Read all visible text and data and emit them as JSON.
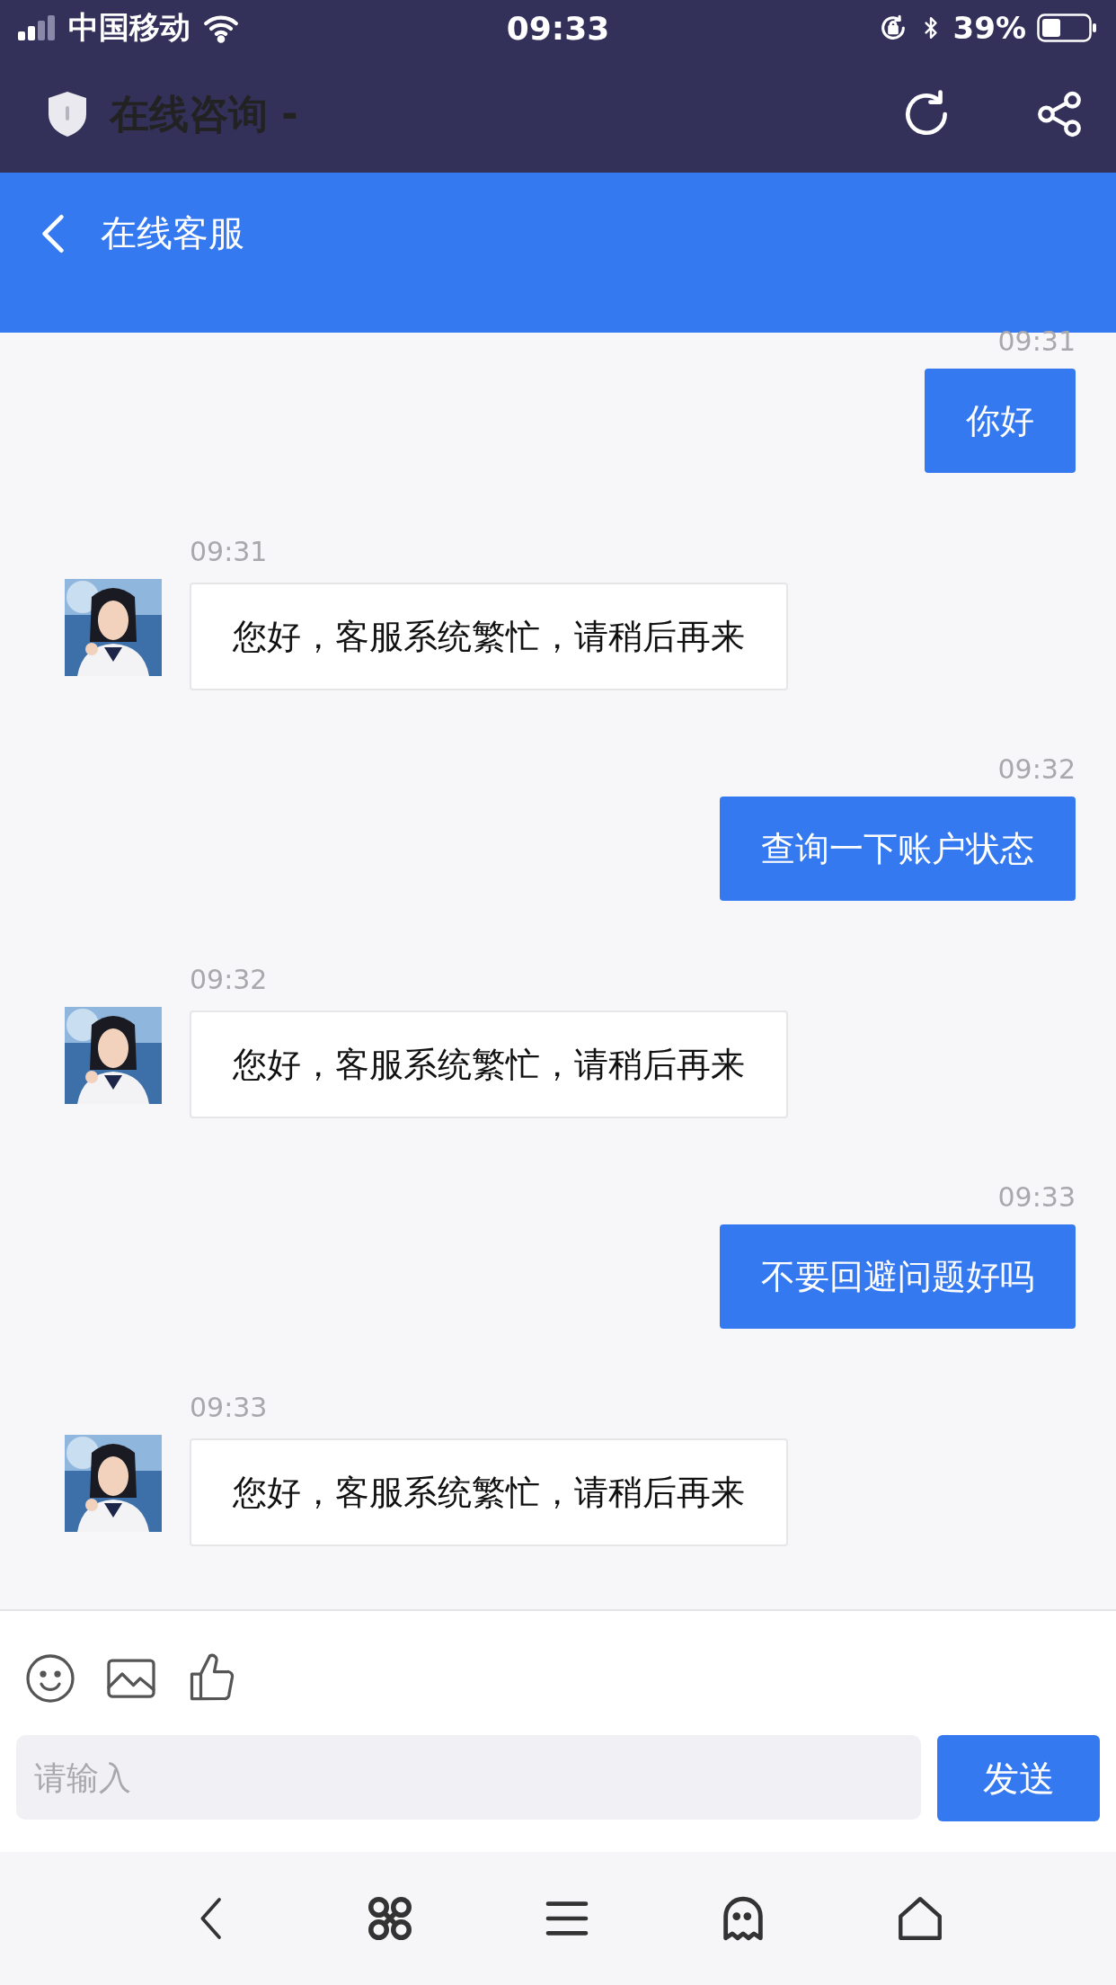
{
  "status_bar": {
    "carrier": "中国移动",
    "time": "09:33",
    "battery": "39%"
  },
  "browser_bar": {
    "title": "在线咨询 -"
  },
  "header": {
    "title": "在线客服"
  },
  "messages": [
    {
      "kind": "sent",
      "time": "09:31",
      "text": "你好"
    },
    {
      "kind": "received",
      "time": "09:31",
      "text": "您好，客服系统繁忙，请稍后再来"
    },
    {
      "kind": "sent",
      "time": "09:32",
      "text": "查询一下账户状态"
    },
    {
      "kind": "received",
      "time": "09:32",
      "text": "您好，客服系统繁忙，请稍后再来"
    },
    {
      "kind": "sent",
      "time": "09:33",
      "text": "不要回避问题好吗"
    },
    {
      "kind": "received",
      "time": "09:33",
      "text": "您好，客服系统繁忙，请稍后再来"
    }
  ],
  "composer": {
    "placeholder": "请输入",
    "send": "发送"
  }
}
